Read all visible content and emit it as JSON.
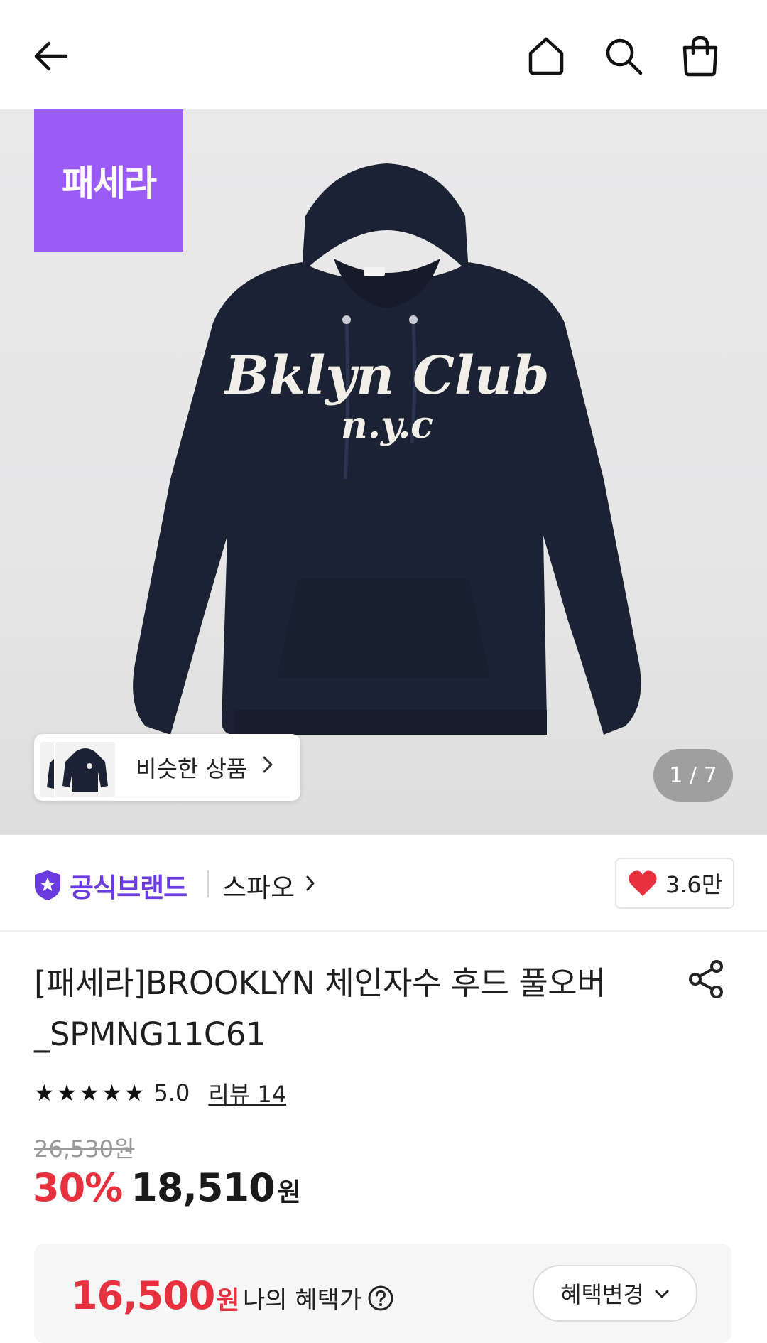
{
  "header": {
    "back_icon": "arrow-left-icon",
    "home_icon": "home-icon",
    "search_icon": "search-icon",
    "bag_icon": "shopping-bag-icon"
  },
  "hero": {
    "promo_badge": "패세라",
    "similar_label": "비슷한 상품",
    "page_indicator": "1 / 7",
    "graphic_text_line1": "Bklyn Club",
    "graphic_text_line2": "n.y.c"
  },
  "brand": {
    "official_label": "공식브랜드",
    "brand_name": "스파오",
    "like_count": "3.6만"
  },
  "product": {
    "title_line1": "[패세라]BROOKLYN 체인자수 후드 풀오버",
    "title_line2": "_SPMNG11C61",
    "rating": "5.0",
    "review_link": "리뷰 14",
    "original_price": "26,530원",
    "discount_rate": "30%",
    "sale_price": "18,510",
    "price_unit": "원"
  },
  "benefit": {
    "price": "16,500",
    "unit": "원",
    "label": "나의 혜택가",
    "change_button": "혜택변경"
  },
  "colors": {
    "accent_purple": "#6a3cde",
    "promo_purple": "#9b5cf6",
    "sale_red": "#e8313f",
    "hoodie_navy": "#1b2233"
  }
}
